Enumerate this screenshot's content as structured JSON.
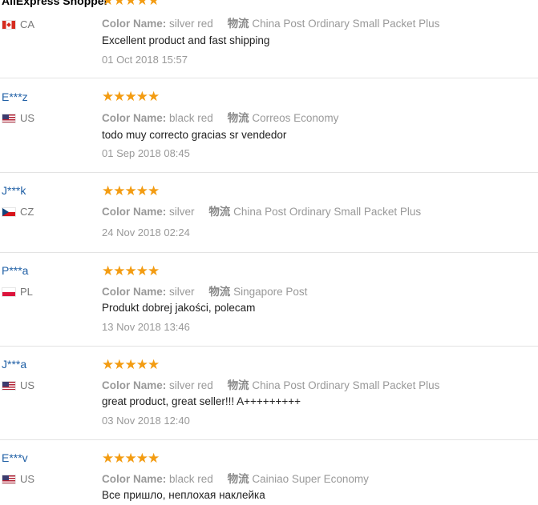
{
  "labels": {
    "color_name": "Color Name:",
    "logistics": "物流"
  },
  "reviews": [
    {
      "user": "AliExpress Shopper",
      "country": "CA",
      "stars": "★★★★★",
      "color": "silver red",
      "shipping": "China Post Ordinary Small Packet Plus",
      "comment": "Excellent product and fast shipping",
      "date": "01 Oct 2018 15:57"
    },
    {
      "user": "E***z",
      "country": "US",
      "stars": "★★★★★",
      "color": "black red",
      "shipping": "Correos Economy",
      "comment": "todo muy correcto gracias sr vendedor",
      "date": "01 Sep 2018 08:45"
    },
    {
      "user": "J***k",
      "country": "CZ",
      "stars": "★★★★★",
      "color": "silver",
      "shipping": "China Post Ordinary Small Packet Plus",
      "comment": "",
      "date": "24 Nov 2018 02:24"
    },
    {
      "user": "P***a",
      "country": "PL",
      "stars": "★★★★★",
      "color": "silver",
      "shipping": "Singapore Post",
      "comment": "Produkt dobrej jakości, polecam",
      "date": "13 Nov 2018 13:46"
    },
    {
      "user": "J***a",
      "country": "US",
      "stars": "★★★★★",
      "color": "silver red",
      "shipping": "China Post Ordinary Small Packet Plus",
      "comment": "great product, great seller!!! A+++++++++",
      "date": "03 Nov 2018 12:40"
    },
    {
      "user": "E***v",
      "country": "US",
      "stars": "★★★★★",
      "color": "black red",
      "shipping": "Cainiao Super Economy",
      "comment": "Все пришло, неплохая наклейка",
      "date": ""
    }
  ],
  "colors": {
    "star": "#f39c12",
    "username": "#1f5fa5",
    "muted": "#999999",
    "divider": "#e3e3e3"
  }
}
